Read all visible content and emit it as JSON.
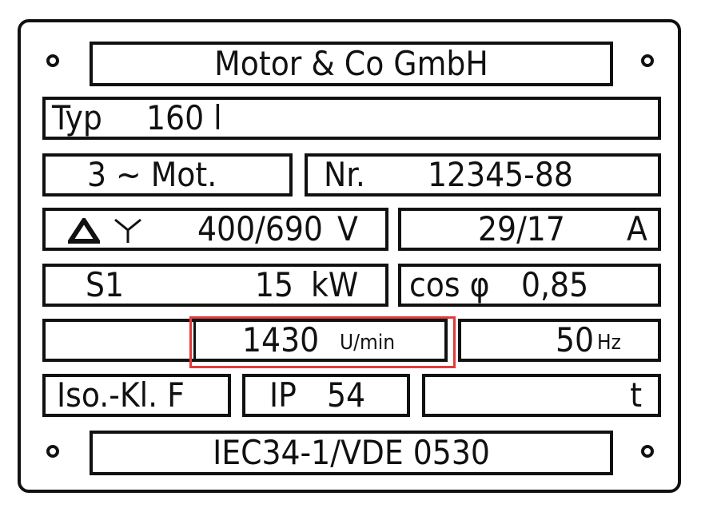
{
  "manufacturer": "Motor & Co GmbH",
  "type_label": "Typ",
  "type_value": "160 l",
  "phase": "3 ~ Mot.",
  "nr_label": "Nr.",
  "nr_value": "12345-88",
  "voltage_value": "400/690",
  "voltage_unit": "V",
  "current_value": "29/17",
  "current_unit": "A",
  "duty": "S1",
  "power_value": "15",
  "power_unit": "kW",
  "cosphi_label": "cos φ",
  "cosphi_value": "0,85",
  "speed_value": "1430",
  "speed_unit": "U/min",
  "freq_value": "50",
  "freq_unit": "Hz",
  "insulation": "Iso.-Kl. F",
  "ip_label": "IP",
  "ip_value": "54",
  "weight_unit": "t",
  "standard": "IEC34-1/VDE 0530",
  "highlight_color": "#e23b3b"
}
